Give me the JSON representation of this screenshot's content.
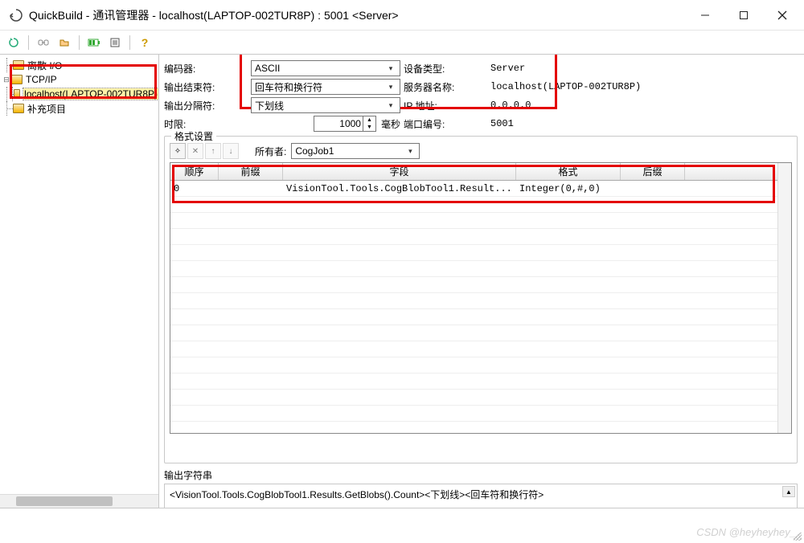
{
  "window": {
    "title": "QuickBuild - 通讯管理器 - localhost(LAPTOP-002TUR8P) : 5001 <Server>"
  },
  "tree": {
    "items": [
      {
        "label": "离散 I/O",
        "type": "folder"
      },
      {
        "label": "TCP/IP",
        "type": "folder"
      },
      {
        "label": "localhost(LAPTOP-002TUR8P)",
        "type": "folder",
        "selected": true
      },
      {
        "label": "补充项目",
        "type": "folder"
      }
    ]
  },
  "settings": {
    "encoder_label": "编码器:",
    "encoder_value": "ASCII",
    "device_type_label": "设备类型:",
    "device_type_value": "Server",
    "output_terminator_label": "输出结束符:",
    "output_terminator_value": "回车符和换行符",
    "server_name_label": "服务器名称:",
    "server_name_value": "localhost(LAPTOP-002TUR8P)",
    "output_separator_label": "输出分隔符:",
    "output_separator_value": "下划线",
    "ip_label": "IP 地址:",
    "ip_value": "0.0.0.0",
    "timeout_label": "时限:",
    "timeout_value": "1000",
    "timeout_unit": "毫秒",
    "port_label": "端口编号:",
    "port_value": "5001"
  },
  "format_group": {
    "title": "格式设置",
    "owner_label": "所有者:",
    "owner_value": "CogJob1",
    "columns": {
      "order": "顺序",
      "prefix": "前缀",
      "field": "字段",
      "format": "格式",
      "suffix": "后缀"
    },
    "rows": [
      {
        "order": "0",
        "prefix": "",
        "field": "VisionTool.Tools.CogBlobTool1.Result...",
        "format": "Integer(0,#,0)",
        "suffix": ""
      }
    ]
  },
  "output": {
    "label": "输出字符串",
    "value": "<VisionTool.Tools.CogBlobTool1.Results.GetBlobs().Count><下划线><回车符和换行符>"
  },
  "watermark": "CSDN @heyheyhey_"
}
